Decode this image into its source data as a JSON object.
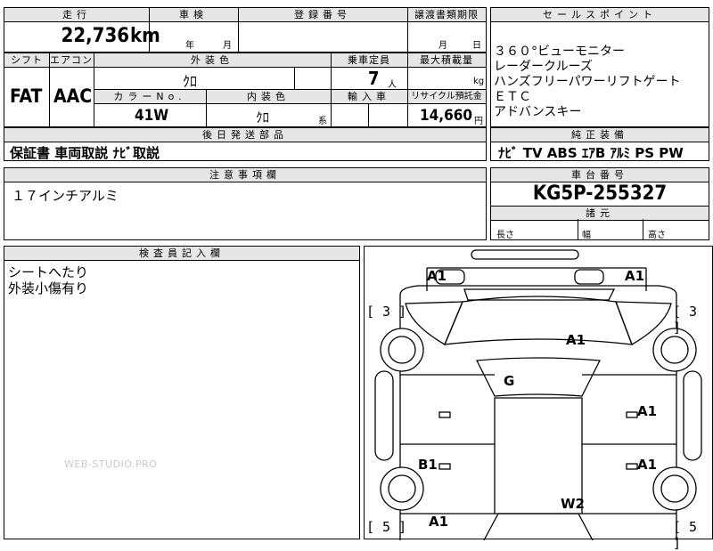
{
  "top": {
    "distance_header": "走行",
    "distance_value": "22,736",
    "distance_unit": "km",
    "inspection_header": "車検",
    "inspection_year": "年",
    "inspection_month": "月",
    "registration_header": "登録番号",
    "transfer_header": "譲渡書類期限",
    "transfer_month": "月",
    "transfer_day": "日"
  },
  "row2": {
    "shift_header": "シフト",
    "aircon_header": "エアコン",
    "exterior_header": "外装色",
    "exterior_value": "ｸﾛ",
    "capacity_header": "乗車定員",
    "capacity_value": "7",
    "capacity_unit": "人",
    "maxload_header": "最大積載量",
    "maxload_unit": "kg",
    "shift_value": "FAT",
    "aircon_value": "AAC",
    "color_no_header": "カラーNo.",
    "color_no_value": "41W",
    "interior_header": "内装色",
    "interior_value": "ｸﾛ",
    "interior_suffix": "系",
    "import_header": "輸入車",
    "recycle_header": "リサイクル預託金",
    "recycle_value": "14,660",
    "recycle_unit": "円"
  },
  "later_parts": {
    "header": "後日発送部品",
    "value": "保証書 車両取説 ﾅﾋﾞ取説"
  },
  "notes": {
    "header": "注意事項欄",
    "value": "１７インチアルミ"
  },
  "inspector": {
    "header": "検査員記入欄",
    "lines": [
      "シートへたり",
      "外装小傷有り"
    ]
  },
  "sales_points": {
    "header": "セールスポイント",
    "items": [
      "３６０°ビューモニター",
      "レーダークルーズ",
      "ハンズフリーパワーリフトゲート",
      "ＥＴＣ",
      "アドバンスキー"
    ]
  },
  "equipment": {
    "header": "純正装備",
    "value": "ﾅﾋﾞ TV ABS ｴｱB ｱﾙﾐ PS PW"
  },
  "chassis": {
    "header": "車台番号",
    "value": "KG5P-255327"
  },
  "specs": {
    "header": "諸元",
    "length": "長さ",
    "width": "幅",
    "height": "高さ"
  },
  "diagram": {
    "marks": {
      "a1_top_left": "A1",
      "a1_top_right": "A1",
      "bracket_left_top": "[ 3 ]",
      "bracket_right_top": "[ 3 ]",
      "a1_hood": "A1",
      "g_windshield": "G",
      "a1_right_front_door": "A1",
      "b1_left_rear_door": "B1",
      "a1_right_rear_door": "A1",
      "w2_rear": "W2",
      "a1_bottom_left": "A1",
      "bracket_left_bottom": "[ 5 ]",
      "bracket_right_bottom": "[ 5 ]"
    }
  },
  "watermark": "WEB-STUDIO.PRO"
}
